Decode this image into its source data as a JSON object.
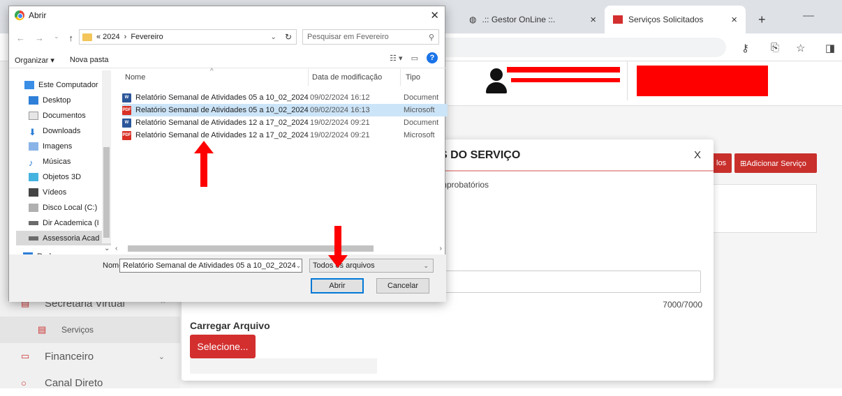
{
  "browser": {
    "tabs": [
      {
        "label": ".:: Gestor OnLine ::."
      },
      {
        "label": "Serviços Solicitados"
      }
    ],
    "new_tab": "+",
    "close": "×"
  },
  "sidebar": {
    "items": [
      {
        "label": "Secretaria Virtual"
      },
      {
        "label": "Serviços"
      },
      {
        "label": "Financeiro"
      },
      {
        "label": "Canal Direto"
      }
    ]
  },
  "page": {
    "buttons": {
      "partial": "los",
      "add_service": "⊞Adicionar Serviço"
    }
  },
  "modal": {
    "title": "S DO SERVIÇO",
    "close": "X",
    "subtitle": "mprobatórios",
    "counter": "7000/7000",
    "upload_label": "Carregar Arquivo",
    "select_button": "Selecione..."
  },
  "dialog": {
    "title": "Abrir",
    "path": [
      "« 2024",
      "›",
      "Fevereiro"
    ],
    "search_placeholder": "Pesquisar em Fevereiro",
    "toolbar": {
      "organize": "Organizar ▾",
      "new_folder": "Nova pasta"
    },
    "nav_items": [
      {
        "label": "Este Computador"
      },
      {
        "label": "Desktop"
      },
      {
        "label": "Documentos"
      },
      {
        "label": "Downloads"
      },
      {
        "label": "Imagens"
      },
      {
        "label": "Músicas"
      },
      {
        "label": "Objetos 3D"
      },
      {
        "label": "Vídeos"
      },
      {
        "label": "Disco Local (C:)"
      },
      {
        "label": "Dir Academica (I"
      },
      {
        "label": "Assessoria Acad"
      },
      {
        "label": "Rede"
      }
    ],
    "columns": {
      "name": "Nome",
      "date": "Data de modificação",
      "type": "Tipo"
    },
    "files": [
      {
        "name": "Relatório Semanal de Atividades 05 a 10_02_2024",
        "date": "09/02/2024 16:12",
        "type": "Document",
        "kind": "word"
      },
      {
        "name": "Relatório Semanal de Atividades 05 a 10_02_2024",
        "date": "09/02/2024 16:13",
        "type": "Microsoft",
        "kind": "pdf"
      },
      {
        "name": "Relatório Semanal de Atividades 12 a 17_02_2024",
        "date": "19/02/2024 09:21",
        "type": "Document",
        "kind": "word"
      },
      {
        "name": "Relatório Semanal de Atividades 12 a 17_02_2024",
        "date": "19/02/2024 09:21",
        "type": "Microsoft",
        "kind": "pdf"
      }
    ],
    "name_label": "Nome:",
    "name_value": "Relatório Semanal de Atividades 05 a 10_02_2024",
    "file_type": "Todos os arquivos",
    "open_button": "Abrir",
    "cancel_button": "Cancelar"
  },
  "colors": {
    "accent_red": "#d32f2f",
    "annotation_red": "#ff0000",
    "selection_blue": "#cce4f7"
  }
}
